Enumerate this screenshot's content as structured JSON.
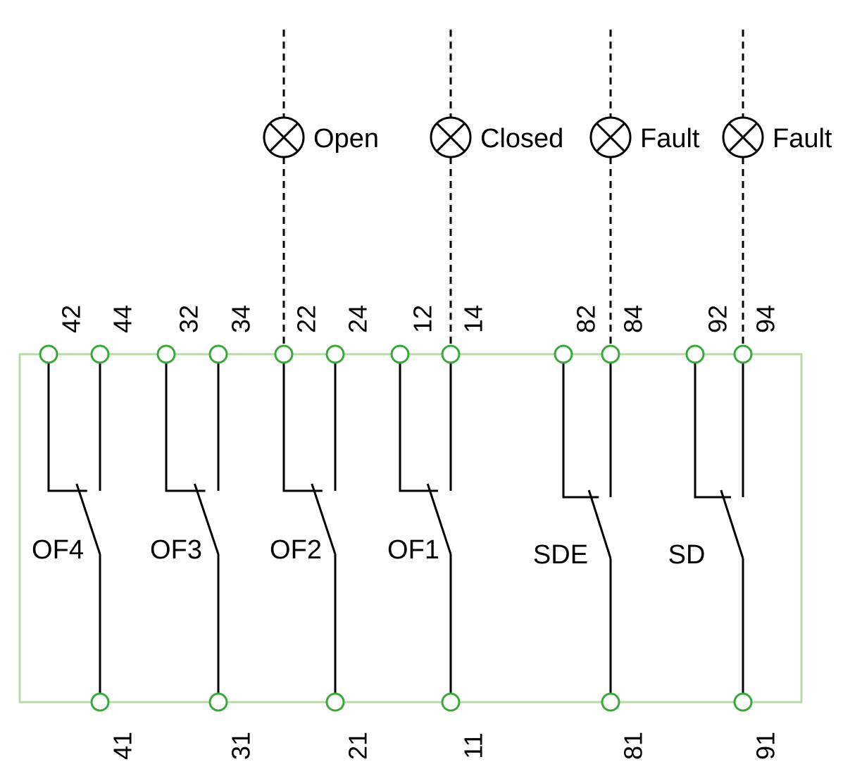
{
  "diagram": {
    "type": "auxiliary-contact-wiring",
    "colors": {
      "frame": "#b6dba6",
      "terminal": "#3aa83a",
      "wire": "#000000"
    },
    "contacts": [
      {
        "name": "OF4",
        "common": "41",
        "nc": "42",
        "no": "44"
      },
      {
        "name": "OF3",
        "common": "31",
        "nc": "32",
        "no": "34"
      },
      {
        "name": "OF2",
        "common": "21",
        "nc": "22",
        "no": "24"
      },
      {
        "name": "OF1",
        "common": "11",
        "nc": "12",
        "no": "14"
      },
      {
        "name": "SDE",
        "common": "81",
        "nc": "82",
        "no": "84"
      },
      {
        "name": "SD",
        "common": "91",
        "nc": "92",
        "no": "94"
      }
    ],
    "lamps": [
      {
        "label": "Open",
        "terminal": "22"
      },
      {
        "label": "Closed",
        "terminal": "14"
      },
      {
        "label": "Fault",
        "terminal": "84"
      },
      {
        "label": "Fault",
        "terminal": "94"
      }
    ]
  }
}
